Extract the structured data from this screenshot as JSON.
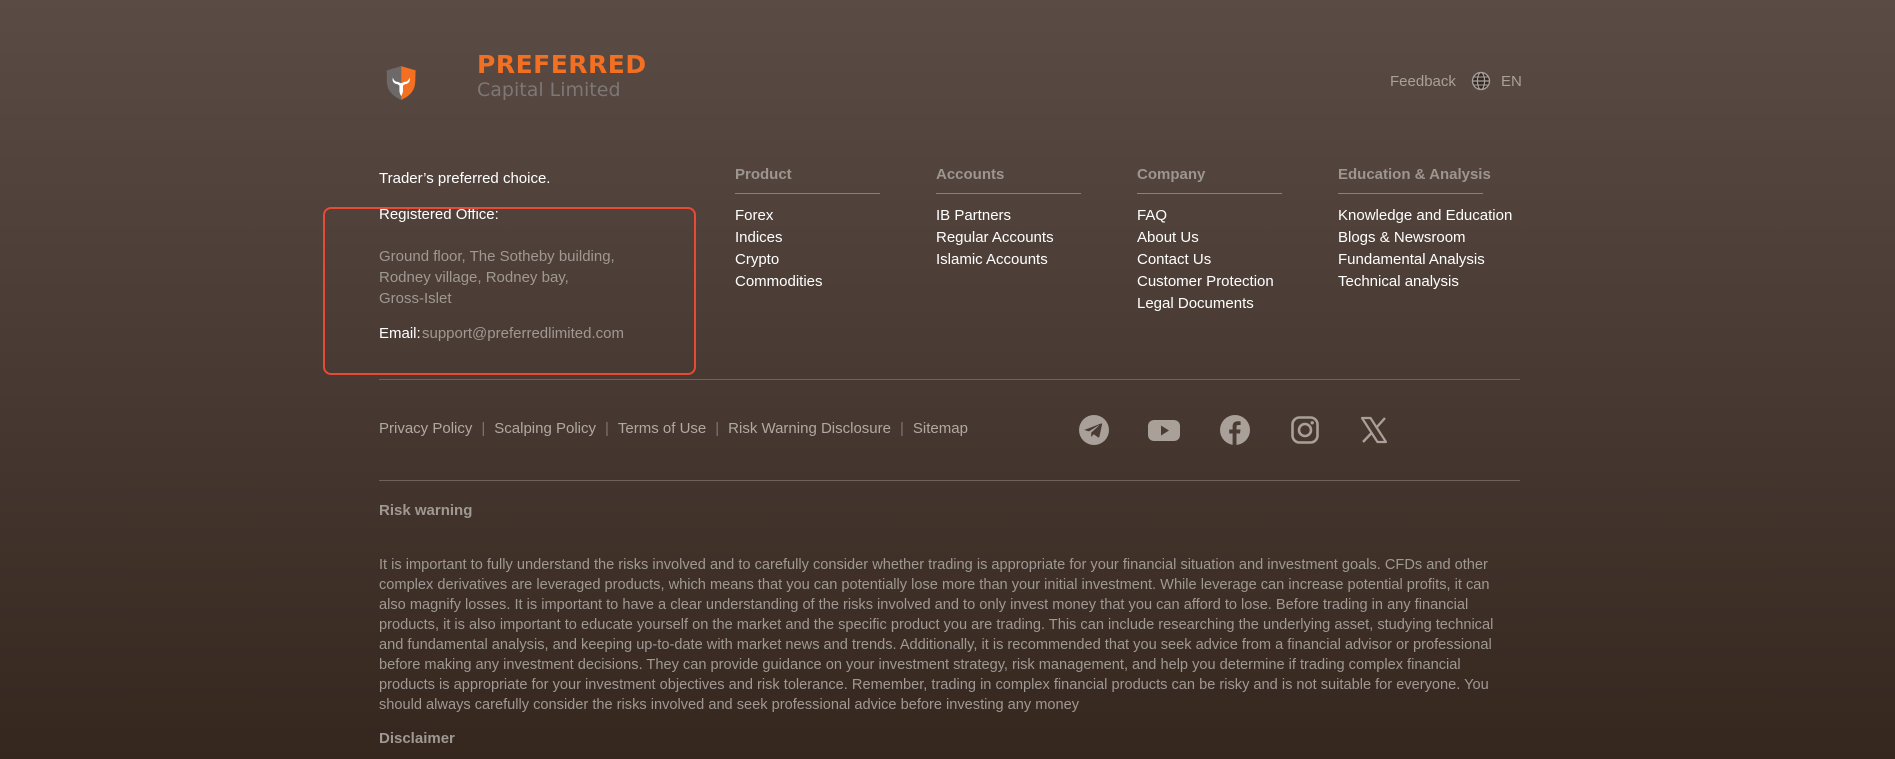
{
  "brand": {
    "name_line1": "PREFERRED",
    "name_line2": "Capital Limited"
  },
  "header": {
    "feedback": "Feedback",
    "language": "EN"
  },
  "company_info": {
    "tagline": "Trader’s preferred choice.",
    "registered_office_label": "Registered Office:",
    "address_lines": [
      "Ground floor, The Sotheby building,",
      "Rodney village, Rodney bay,",
      "Gross-Islet"
    ],
    "email_label": "Email:",
    "email_value": "support@preferredlimited.com"
  },
  "columns": [
    {
      "title": "Product",
      "links": [
        "Forex",
        "Indices",
        "Crypto",
        "Commodities"
      ]
    },
    {
      "title": "Accounts",
      "links": [
        "IB Partners",
        "Regular Accounts",
        "Islamic Accounts"
      ]
    },
    {
      "title": "Company",
      "links": [
        "FAQ",
        "About Us",
        "Contact Us",
        "Customer Protection",
        "Legal Documents"
      ]
    },
    {
      "title": "Education & Analysis",
      "links": [
        "Knowledge and Education",
        "Blogs & Newsroom",
        "Fundamental Analysis",
        "Technical analysis"
      ]
    }
  ],
  "bottom_links": [
    "Privacy Policy",
    "Scalping Policy",
    "Terms of Use",
    "Risk Warning Disclosure",
    "Sitemap"
  ],
  "bottom_separator": "|",
  "social": [
    "telegram-icon",
    "youtube-icon",
    "facebook-icon",
    "instagram-icon",
    "x-icon"
  ],
  "risk": {
    "title": "Risk warning",
    "text": "It is important to fully understand the risks involved and to carefully consider whether trading is appropriate for your financial situation and investment goals. CFDs and other complex derivatives are leveraged products, which means that you can potentially lose more than your initial investment. While leverage can increase potential profits, it can also magnify losses. It is important to have a clear understanding of the risks involved and to only invest money that you can afford to lose. Before trading in any financial products, it is also important to educate yourself on the market and the specific product you are trading. This can include researching the underlying asset, studying technical and fundamental analysis, and keeping up-to-date with market news and trends. Additionally, it is recommended that you seek advice from a financial advisor or professional before making any investment decisions. They can provide guidance on your investment strategy, risk management, and help you determine if trading complex financial products is appropriate for your investment objectives and risk tolerance. Remember, trading in complex financial products can be risky and is not suitable for everyone. You should always carefully consider the risks involved and seek professional advice before investing any money",
    "disclaimer_title": "Disclaimer"
  },
  "colors": {
    "accent": "#f36f21",
    "highlight_border": "#e84a36"
  }
}
